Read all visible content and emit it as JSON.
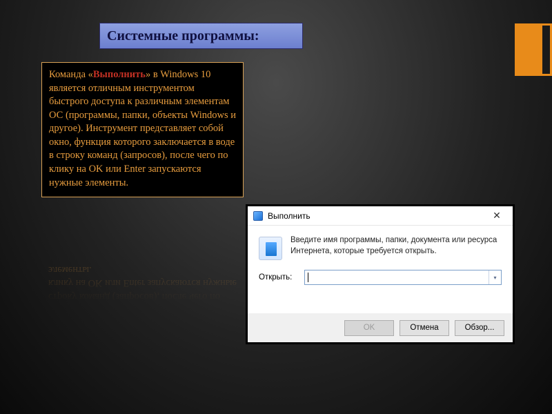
{
  "title": "Системные программы:",
  "desc": {
    "p1a": "Команда «",
    "kw": "Выполнить",
    "p1b": "» в Windows 10 является отличным инструментом быстрого доступа к различным элементам ОС (программы, папки, объекты Windows и другое). Инструмент представляет собой окно, функция которого заключается в воде в строку команд (запросов), после чего по клику на OK или Enter запускаются нужные элементы."
  },
  "reflection_tail": "строку команд (запросов), после чего по клику на OK или Enter запускаются нужные элементы.",
  "run": {
    "title": "Выполнить",
    "hint": "Введите имя программы, папки, документа или ресурса Интернета, которые требуется открыть.",
    "open_label": "Открыть:",
    "ok": "OK",
    "cancel": "Отмена",
    "browse": "Обзор..."
  }
}
